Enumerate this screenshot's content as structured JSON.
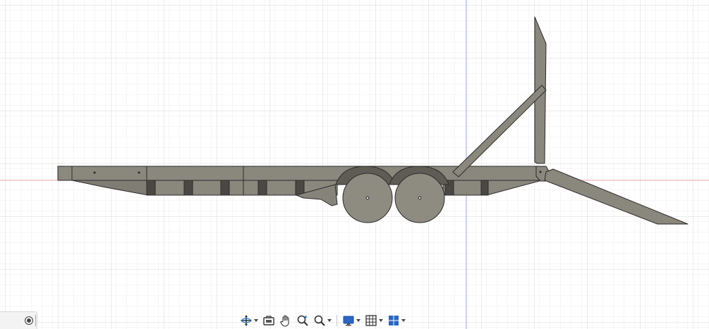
{
  "viewport": {
    "background": "#ffffff",
    "grid_minor_color": "#ececec",
    "grid_major_color": "#d4d4d4",
    "x_axis_color": "#f0a8a8",
    "y_axis_color": "#a6a6f2",
    "model_color": "#8a877d",
    "model_edge_color": "#2b2b2b"
  },
  "model": {
    "name": "flatbed-trailer",
    "parts": [
      "deck",
      "wheels",
      "ramp",
      "tailgate",
      "brace"
    ]
  },
  "toolbar": {
    "tools": [
      {
        "name": "orbit-icon",
        "has_menu": true
      },
      {
        "name": "look-at-icon",
        "has_menu": false
      },
      {
        "name": "pan-icon",
        "has_menu": false
      },
      {
        "name": "zoom-icon",
        "has_menu": false
      },
      {
        "name": "fit-icon",
        "has_menu": true
      },
      {
        "name": "display-settings-icon",
        "has_menu": true
      },
      {
        "name": "grid-settings-icon",
        "has_menu": true
      },
      {
        "name": "viewports-icon",
        "has_menu": true
      }
    ]
  }
}
